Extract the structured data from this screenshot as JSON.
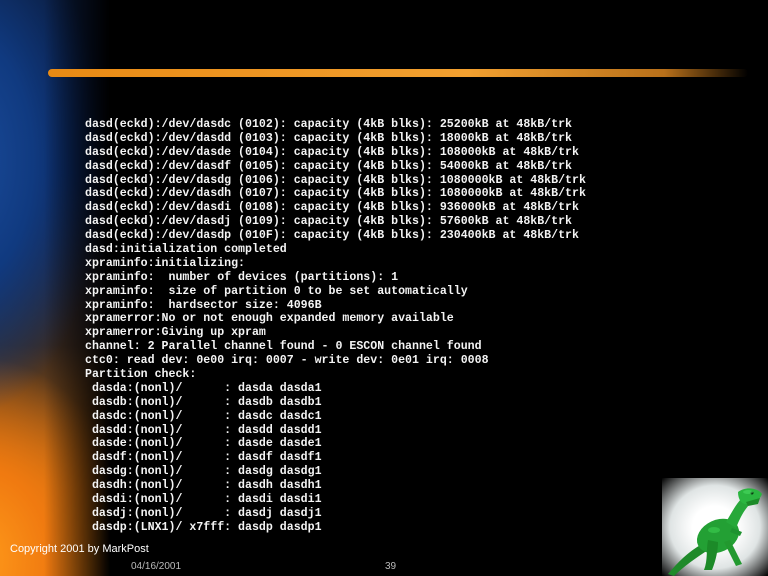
{
  "slide": {
    "copyright": "Copyright 2001 by MarkPost",
    "date": "04/16/2001",
    "page_number": "39",
    "colors": {
      "background": "#000000",
      "accent": "#e88a14",
      "text": "#f4f4f4"
    }
  },
  "console": {
    "lines": [
      "dasd(eckd):/dev/dasdc (0102): capacity (4kB blks): 25200kB at 48kB/trk",
      "dasd(eckd):/dev/dasdd (0103): capacity (4kB blks): 18000kB at 48kB/trk",
      "dasd(eckd):/dev/dasde (0104): capacity (4kB blks): 108000kB at 48kB/trk",
      "dasd(eckd):/dev/dasdf (0105): capacity (4kB blks): 54000kB at 48kB/trk",
      "dasd(eckd):/dev/dasdg (0106): capacity (4kB blks): 1080000kB at 48kB/trk",
      "dasd(eckd):/dev/dasdh (0107): capacity (4kB blks): 1080000kB at 48kB/trk",
      "dasd(eckd):/dev/dasdi (0108): capacity (4kB blks): 936000kB at 48kB/trk",
      "dasd(eckd):/dev/dasdj (0109): capacity (4kB blks): 57600kB at 48kB/trk",
      "dasd(eckd):/dev/dasdp (010F): capacity (4kB blks): 230400kB at 48kB/trk",
      "dasd:initialization completed",
      "xpraminfo:initializing:",
      "xpraminfo:  number of devices (partitions): 1",
      "xpraminfo:  size of partition 0 to be set automatically",
      "xpraminfo:  hardsector size: 4096B",
      "xpramerror:No or not enough expanded memory available",
      "xpramerror:Giving up xpram",
      "channel: 2 Parallel channel found - 0 ESCON channel found",
      "ctc0: read dev: 0e00 irq: 0007 - write dev: 0e01 irq: 0008",
      "Partition check:",
      " dasda:(nonl)/      : dasda dasda1",
      " dasdb:(nonl)/      : dasdb dasdb1",
      " dasdc:(nonl)/      : dasdc dasdc1",
      " dasdd:(nonl)/      : dasdd dasdd1",
      " dasde:(nonl)/      : dasde dasde1",
      " dasdf:(nonl)/      : dasdf dasdf1",
      " dasdg:(nonl)/      : dasdg dasdg1",
      " dasdh:(nonl)/      : dasdh dasdh1",
      " dasdi:(nonl)/      : dasdi dasdi1",
      " dasdj:(nonl)/      : dasdj dasdj1",
      " dasdp:(LNX1)/ x7fff: dasdp dasdp1"
    ]
  },
  "icons": {
    "mascot": "green-dinosaur-icon"
  }
}
